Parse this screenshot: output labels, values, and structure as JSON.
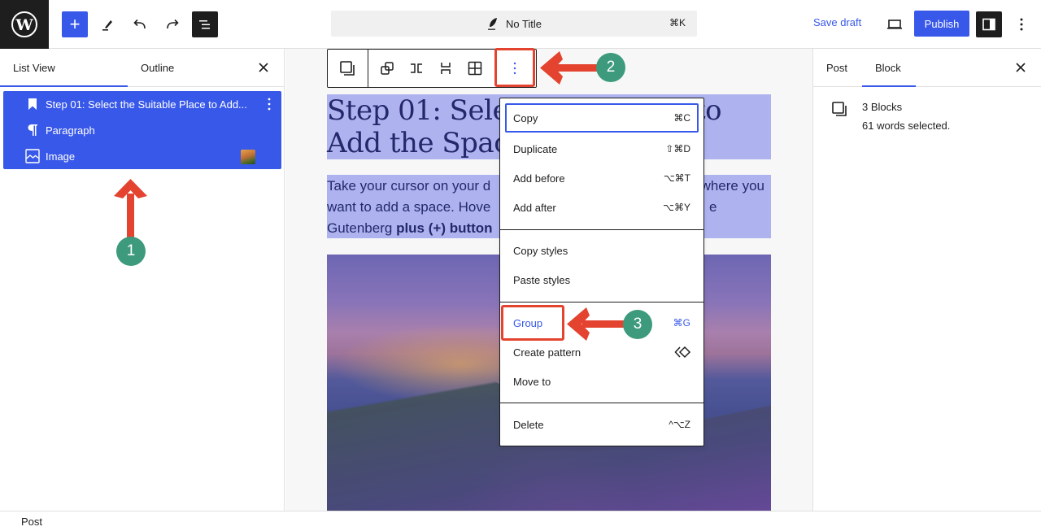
{
  "topbar": {
    "logo": "wordpress-logo",
    "add_block_label": "+",
    "doc_title": "No Title",
    "command_shortcut": "⌘K",
    "save_draft_label": "Save draft",
    "publish_label": "Publish"
  },
  "left_panel": {
    "tabs": [
      {
        "label": "List View",
        "active": true
      },
      {
        "label": "Outline",
        "active": false
      }
    ],
    "items": [
      {
        "label": "Step 01: Select the Suitable Place to Add...",
        "icon": "heading-bookmark-icon"
      },
      {
        "label": "Paragraph",
        "icon": "paragraph-icon"
      },
      {
        "label": "Image",
        "icon": "image-icon"
      }
    ]
  },
  "canvas": {
    "heading": "Step 01: Select the Suitable Place to Add the Spacer",
    "heading_visible_left_line1": "Step 01: Select",
    "heading_visible_left_line2": "Add the Spacer",
    "heading_visible_right": "to",
    "paragraph_parts": {
      "line1_left": "Take your cursor on your d",
      "line1_right": "where you",
      "line2_left": "want to add a space. Hove",
      "line2_right": "e",
      "line3_left": "Gutenberg ",
      "line3_bold": "plus (+) button"
    }
  },
  "block_menu": {
    "groups": [
      [
        {
          "label": "Copy",
          "shortcut": "⌘C",
          "focused": true
        },
        {
          "label": "Duplicate",
          "shortcut": "⇧⌘D"
        },
        {
          "label": "Add before",
          "shortcut": "⌥⌘T"
        },
        {
          "label": "Add after",
          "shortcut": "⌥⌘Y"
        }
      ],
      [
        {
          "label": "Copy styles",
          "shortcut": ""
        },
        {
          "label": "Paste styles",
          "shortcut": ""
        }
      ],
      [
        {
          "label": "Group",
          "shortcut": "⌘G",
          "highlighted": true
        },
        {
          "label": "Create pattern",
          "shortcut": "",
          "icon": "pattern-diamond-icon"
        },
        {
          "label": "Move to",
          "shortcut": ""
        }
      ],
      [
        {
          "label": "Delete",
          "shortcut": "^⌥Z"
        }
      ]
    ]
  },
  "right_panel": {
    "tabs": [
      {
        "label": "Post",
        "active": false
      },
      {
        "label": "Block",
        "active": true
      }
    ],
    "block_title": "3 Blocks",
    "block_desc": "61 words selected."
  },
  "footer": {
    "breadcrumb": "Post"
  },
  "annotations": [
    {
      "number": "1",
      "target": "list-view-selection"
    },
    {
      "number": "2",
      "target": "options-button"
    },
    {
      "number": "3",
      "target": "group-menu-item"
    }
  ],
  "colors": {
    "accent": "#3858e9",
    "selection": "#aeb3f0",
    "annotation_red": "#e4432f",
    "annotation_green": "#3d9a7c",
    "dark": "#1e1e1e"
  }
}
